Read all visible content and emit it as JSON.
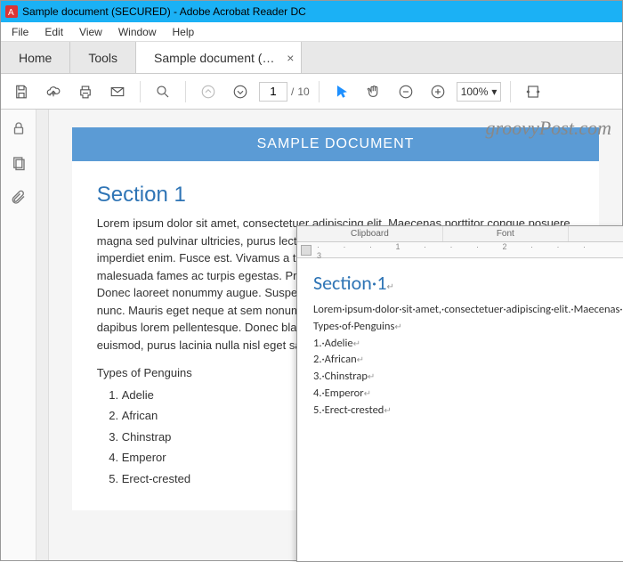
{
  "titlebar": {
    "title": "Sample document (SECURED) - Adobe Acrobat Reader DC"
  },
  "menubar": {
    "file": "File",
    "edit": "Edit",
    "view": "View",
    "window": "Window",
    "help": "Help"
  },
  "tabs": {
    "home": "Home",
    "tools": "Tools",
    "doc": "Sample document (…"
  },
  "toolbar": {
    "page_current": "1",
    "page_sep": "/",
    "page_total": "10",
    "zoom": "100%"
  },
  "watermark": "groovyPost.com",
  "page": {
    "header": "SAMPLE DOCUMENT",
    "section_title": "Section 1",
    "body": "Lorem ipsum dolor sit amet, consectetuer adipiscing elit. Maecenas porttitor congue posuere, magna sed pulvinar ultricies, purus lectus malesuada libero, sit amet quis urna. Nunc viverra imperdiet enim. Fusce est. Vivamus a tellus. Pellentesque tristique senectus et netus et malesuada fames ac turpis egestas. Proin pharetra et orci. Aenean nec lorem. In porttitor. Donec laoreet nonummy augue. Suspendisse scelerisque at, vulputate vitae, pretium mattis, nunc. Mauris eget neque at sem nonummy. Fusce aliquet pede non pede. Suspendisse dapibus lorem pellentesque. Donec blandit feugiat ligula. Donec hendrerit, felis et imperdiet euismod, purus lacinia nulla nisl eget sapien.",
    "types_label": "Types of Penguins",
    "items": [
      "Adelie",
      "African",
      "Chinstrap",
      "Emperor",
      "Erect-crested"
    ]
  },
  "word": {
    "ribbon_clip": "Clipboard",
    "ribbon_font": "Font",
    "ruler": "· · · 1 · · · 2 · · · 3",
    "section": "Section·1",
    "body": "Lorem·ipsum·dolor·sit·amet,·consectetuer·adipiscing·elit.·Maecenas·posuere,·magna·sed·pulvinar·ultricies,·purus·lectus·malesuada·quis·urna.·Nunc·viverra·imperdiet·enim.·Fusce·est.·Vivamus·a·tristique·senectus·et·netus·et·malesuada·fames·ac·turpis·et·orci.·Aenean·nec·lorem.·In·porttitor.·Donec·laoreet·nonummy·scelerisque·at,·vulputate·vitae,·pretium·mattis,·nunc.·Mauris·nonummy.·Fusce·aliquet·pede·non·pede.·Suspendisse·dapibus·Donec·blandit·feugiat·ligula.·Donec·hendrerit,·felis·et·imperdiet·lacinia·nulla·nisl·eget·sapien.",
    "types": "Types·of·Penguins",
    "items": [
      "1.·Adelie",
      "2.·African",
      "3.·Chinstrap",
      "4.·Emperor",
      "5.·Erect-crested"
    ]
  }
}
